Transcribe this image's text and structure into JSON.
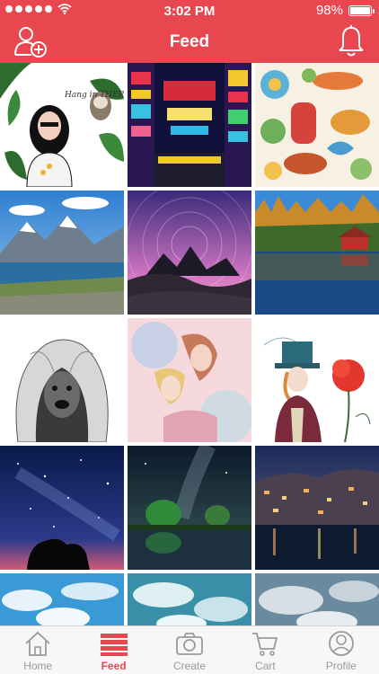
{
  "status_bar": {
    "time": "3:02 PM",
    "battery_level": "98%",
    "battery_fraction": 0.98,
    "signal_bars": 5
  },
  "nav": {
    "title": "Feed",
    "left_icon": "add-user-icon",
    "right_icon": "bell-icon"
  },
  "feed": {
    "images": [
      {
        "subject": "woman-sloth-illustration",
        "label": "Hang in THERE!"
      },
      {
        "subject": "neon-city-street"
      },
      {
        "subject": "floral-pattern-illustration"
      },
      {
        "subject": "mountain-lake-landscape"
      },
      {
        "subject": "star-trails-rocks"
      },
      {
        "subject": "lake-cabin-forest"
      },
      {
        "subject": "hooded-dog-sketch"
      },
      {
        "subject": "watercolor-women-illustration"
      },
      {
        "subject": "mad-hatter-illustration"
      },
      {
        "subject": "starry-night-sky"
      },
      {
        "subject": "milky-way-tree-reflection"
      },
      {
        "subject": "coastal-city-night"
      },
      {
        "subject": "blue-sky-clouds"
      },
      {
        "subject": "teal-clouds"
      },
      {
        "subject": "grey-clouds"
      }
    ]
  },
  "tabs": [
    {
      "label": "Home",
      "icon": "home-icon",
      "active": false
    },
    {
      "label": "Feed",
      "icon": "feed-list-icon",
      "active": true
    },
    {
      "label": "Create",
      "icon": "camera-icon",
      "active": false
    },
    {
      "label": "Cart",
      "icon": "cart-icon",
      "active": false
    },
    {
      "label": "Profile",
      "icon": "profile-icon",
      "active": false
    }
  ],
  "colors": {
    "accent": "#e8474f",
    "tab_inactive": "#9a9a9a",
    "tabbar_bg": "#f7f7f7"
  }
}
